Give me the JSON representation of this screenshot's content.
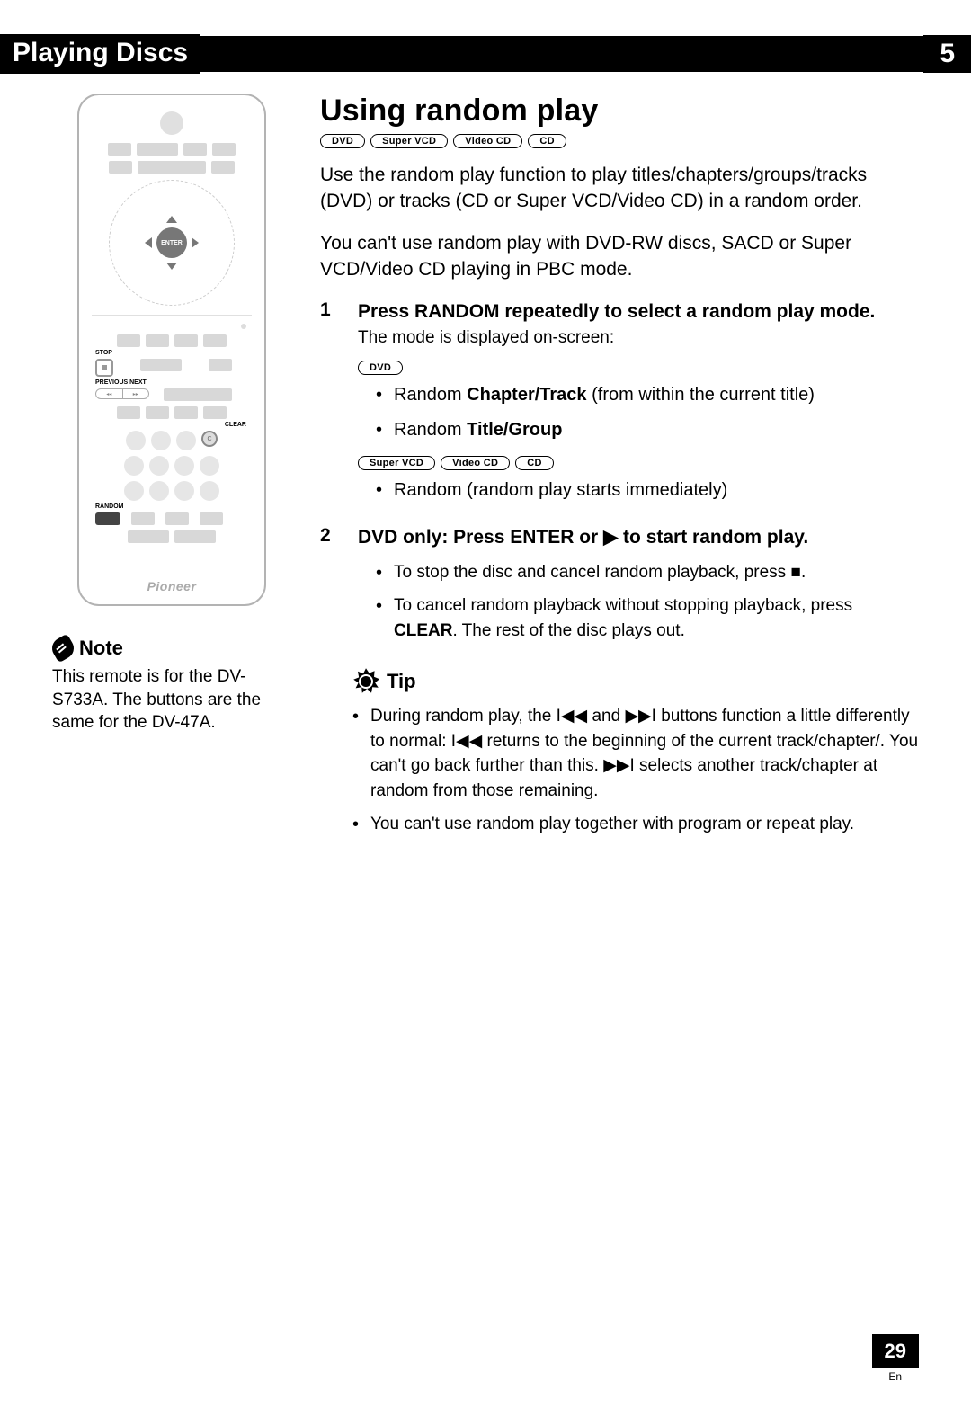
{
  "header": {
    "left": "Playing Discs",
    "right": "5"
  },
  "remote": {
    "enter": "ENTER",
    "stop_label": "STOP",
    "prevnext_label": "PREVIOUS NEXT",
    "clear_label": "CLEAR",
    "clear_btn": "C",
    "random_label": "RANDOM",
    "brand": "Pioneer"
  },
  "note": {
    "title": "Note",
    "body": "This remote is for the DV-S733A. The buttons are the same for the DV-47A."
  },
  "section_title": "Using random play",
  "tags_main": [
    "DVD",
    "Super VCD",
    "Video CD",
    "CD"
  ],
  "para1": "Use the random play function to play titles/chapters/groups/tracks (DVD) or tracks (CD or  Super VCD/Video CD) in a random order.",
  "para2": "You can't use random play with DVD-RW discs, SACD or Super VCD/Video CD playing in PBC mode.",
  "step1": {
    "num": "1",
    "title": "Press RANDOM repeatedly to select a random play mode.",
    "sub": "The mode is displayed on-screen:",
    "tag_dvd": "DVD",
    "b1_pre": "Random ",
    "b1_bold": "Chapter/Track",
    "b1_post": " (from within the current title)",
    "b2_pre": "Random ",
    "b2_bold": "Title/Group",
    "tags_vcd": [
      "Super VCD",
      "Video CD",
      "CD"
    ],
    "b3": "Random (random play starts immediately)"
  },
  "step2": {
    "num": "2",
    "title_pre": "DVD only: Press ENTER or ",
    "title_glyph": "▶",
    "title_post": " to start random play.",
    "b1_pre": "To stop the disc and cancel random playback, press ",
    "b1_glyph": "■",
    "b1_post": ".",
    "b2_pre": "To cancel random playback without stopping playback, press ",
    "b2_bold": "CLEAR",
    "b2_post": ". The rest of the disc plays out."
  },
  "tip": {
    "title": "Tip",
    "b1_a": "During random play, the ",
    "b1_g1": "I◀◀",
    "b1_b": " and ",
    "b1_g2": "▶▶I",
    "b1_c": " buttons function a little differently to normal: ",
    "b1_g3": "I◀◀",
    "b1_d": " returns to the beginning of the current track/chapter/. You can't go back further than this. ",
    "b1_g4": "▶▶I",
    "b1_e": " selects another track/chapter at random from those remaining.",
    "b2": "You can't use random play together with program or repeat play."
  },
  "footer": {
    "page": "29",
    "lang": "En"
  }
}
